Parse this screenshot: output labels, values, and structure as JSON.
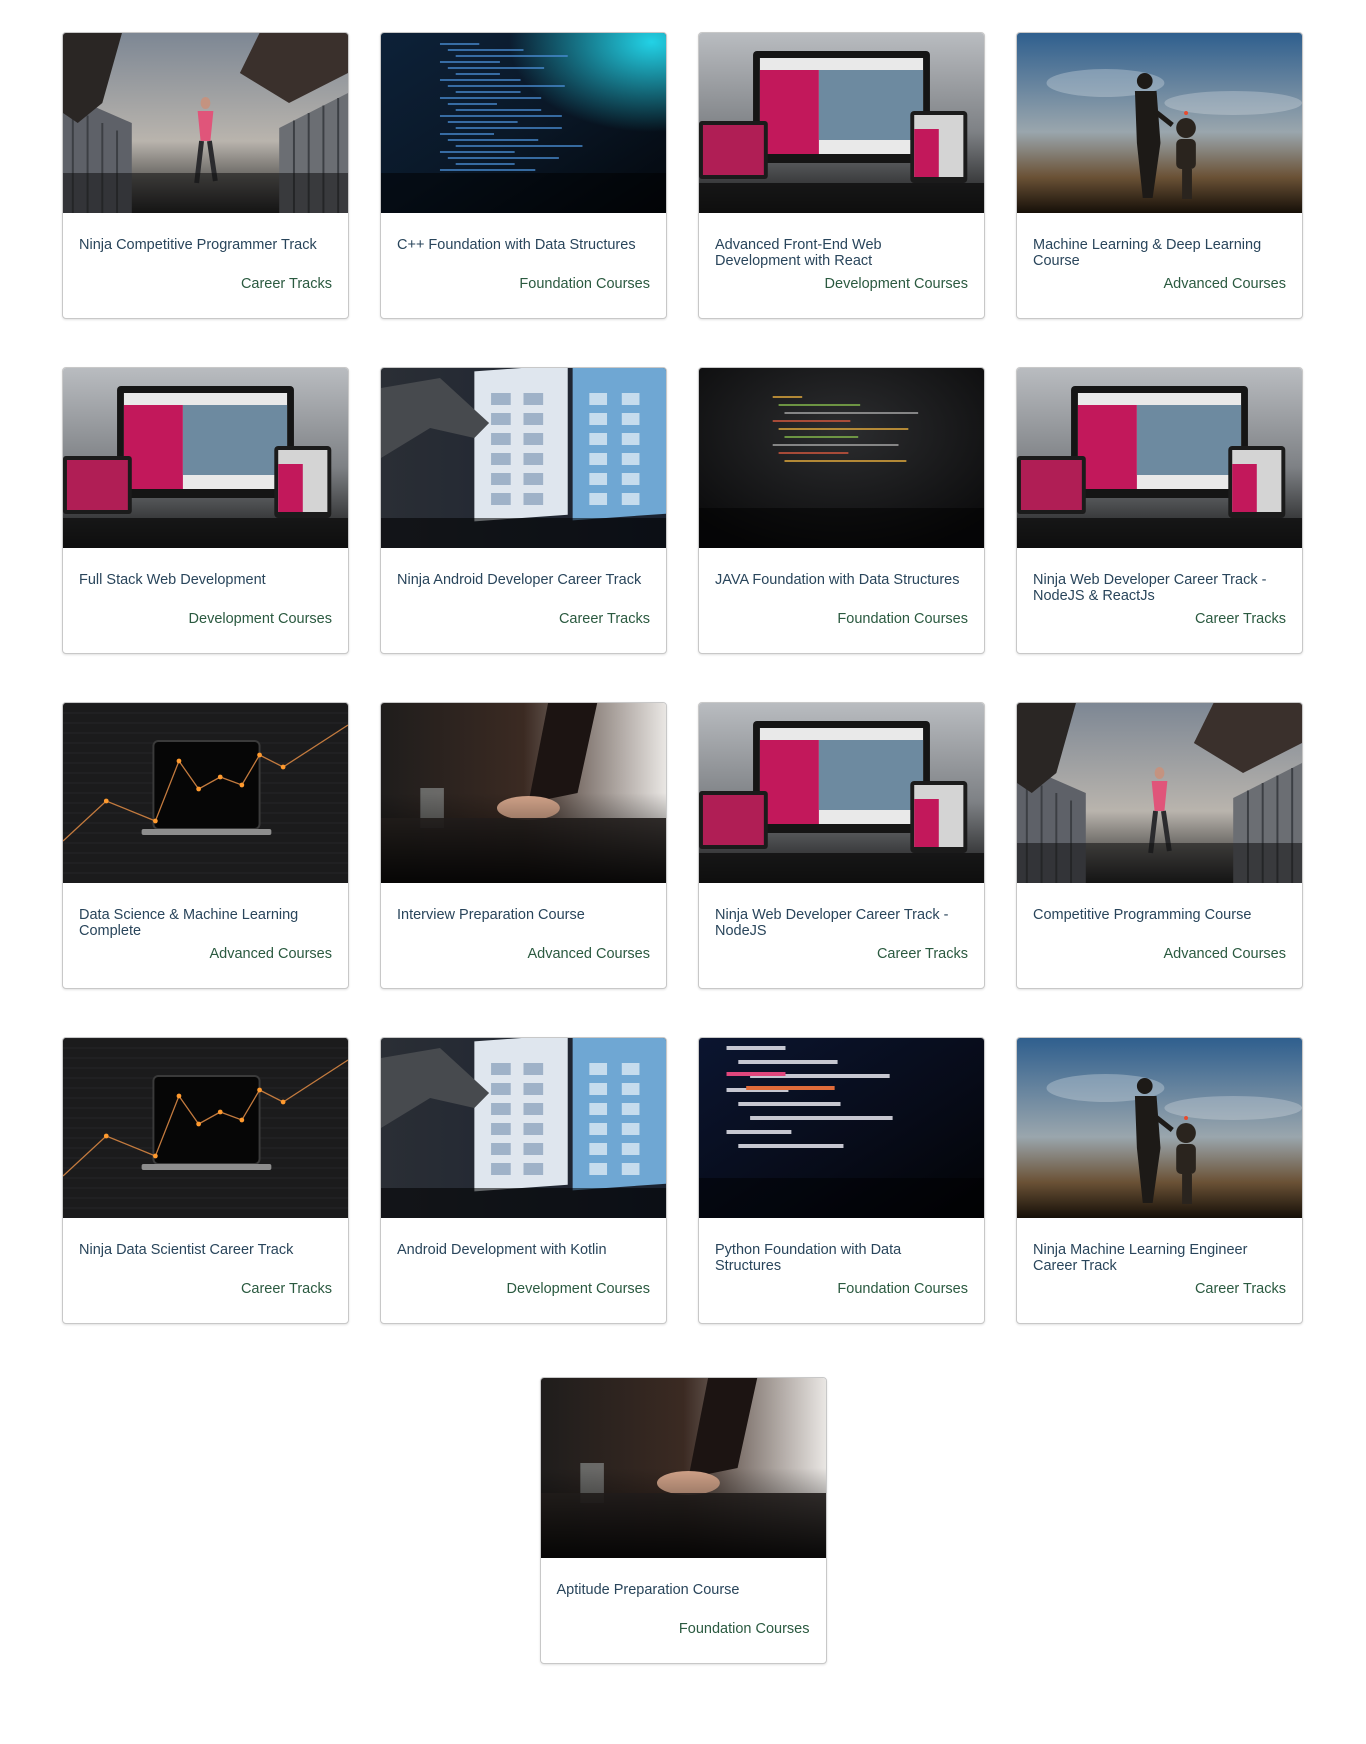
{
  "cards": [
    {
      "title": "Ninja Competitive Programmer Track",
      "category": "Career Tracks",
      "image": "runners-photo"
    },
    {
      "title": "C++ Foundation with Data Structures",
      "category": "Foundation Courses",
      "image": "code-screen-photo"
    },
    {
      "title": "Advanced Front-End Web Development with React",
      "category": "Development Courses",
      "image": "responsive-devices-photo"
    },
    {
      "title": "Machine Learning & Deep Learning Course",
      "category": "Advanced Courses",
      "image": "man-robot-photo"
    },
    {
      "title": "Full Stack Web Development",
      "category": "Development Courses",
      "image": "responsive-devices-photo"
    },
    {
      "title": "Ninja Android Developer Career Track",
      "category": "Career Tracks",
      "image": "touchscreen-photo"
    },
    {
      "title": "JAVA Foundation with Data Structures",
      "category": "Foundation Courses",
      "image": "dark-code-photo"
    },
    {
      "title": "Ninja Web Developer Career Track - NodeJS & ReactJs",
      "category": "Career Tracks",
      "image": "responsive-devices-photo"
    },
    {
      "title": "Data Science & Machine Learning Complete",
      "category": "Advanced Courses",
      "image": "laptop-chart-photo"
    },
    {
      "title": "Interview Preparation Course",
      "category": "Advanced Courses",
      "image": "interview-hands-photo"
    },
    {
      "title": "Ninja Web Developer Career Track - NodeJS",
      "category": "Career Tracks",
      "image": "responsive-devices-photo"
    },
    {
      "title": "Competitive Programming Course",
      "category": "Advanced Courses",
      "image": "runners-photo"
    },
    {
      "title": "Ninja Data Scientist Career Track",
      "category": "Career Tracks",
      "image": "laptop-chart-photo"
    },
    {
      "title": "Android Development with Kotlin",
      "category": "Development Courses",
      "image": "touchscreen-photo"
    },
    {
      "title": "Python Foundation with Data Structures",
      "category": "Foundation Courses",
      "image": "python-code-photo"
    },
    {
      "title": "Ninja Machine Learning Engineer Career Track",
      "category": "Career Tracks",
      "image": "man-robot-photo"
    },
    {
      "title": "Aptitude Preparation Course",
      "category": "Foundation Courses",
      "image": "interview-hands-photo"
    }
  ],
  "colors": {
    "title": "#29455b",
    "category": "#2b5a40",
    "border": "#c8c8c8"
  }
}
